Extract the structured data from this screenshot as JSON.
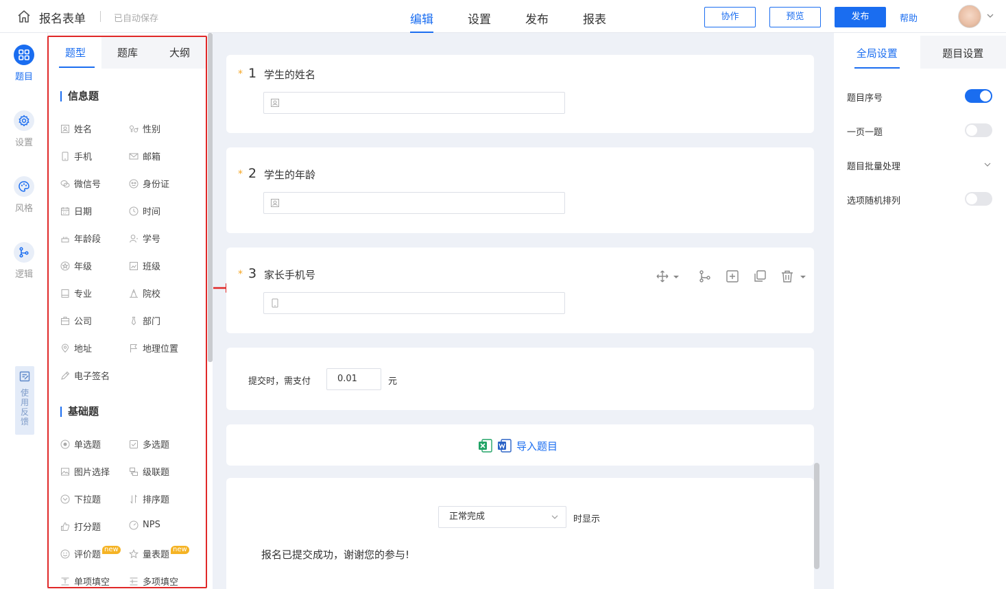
{
  "header": {
    "title": "报名表单",
    "autosave": "已自动保存",
    "tabs": [
      "编辑",
      "设置",
      "发布",
      "报表"
    ],
    "buttons": {
      "collaborate": "协作",
      "preview": "预览",
      "publish": "发布"
    },
    "help": "帮助"
  },
  "rail": {
    "items": [
      {
        "label": "题目",
        "icon": "grid-icon"
      },
      {
        "label": "设置",
        "icon": "gear-icon"
      },
      {
        "label": "风格",
        "icon": "palette-icon"
      },
      {
        "label": "逻辑",
        "icon": "logic-icon"
      }
    ],
    "feedback": "使用反馈"
  },
  "panel": {
    "tabs": [
      "题型",
      "题库",
      "大纲"
    ],
    "info_title": "信息题",
    "info_items": [
      "姓名",
      "性别",
      "手机",
      "邮箱",
      "微信号",
      "身份证",
      "日期",
      "时间",
      "年龄段",
      "学号",
      "年级",
      "班级",
      "专业",
      "院校",
      "公司",
      "部门",
      "地址",
      "地理位置",
      "电子签名"
    ],
    "basic_title": "基础题",
    "basic_items": [
      "单选题",
      "多选题",
      "图片选择",
      "级联题",
      "下拉题",
      "排序题",
      "打分题",
      "NPS",
      "评价题",
      "量表题",
      "单项填空",
      "多项填空"
    ],
    "new_badge": "new"
  },
  "questions": [
    {
      "star": "*",
      "num": "1",
      "title": "学生的姓名"
    },
    {
      "star": "*",
      "num": "2",
      "title": "学生的年龄"
    },
    {
      "star": "*",
      "num": "3",
      "title": "家长手机号"
    }
  ],
  "payment": {
    "label": "提交时，需支付",
    "value": "0.01",
    "unit": "元"
  },
  "import": {
    "label": "导入题目"
  },
  "completion": {
    "select": "正常完成",
    "suffix": "时显示",
    "message": "报名已提交成功，谢谢您的参与!"
  },
  "right": {
    "tabs": [
      "全局设置",
      "题目设置"
    ],
    "settings": [
      {
        "label": "题目序号",
        "on": true
      },
      {
        "label": "一页一题",
        "on": false
      },
      {
        "label": "题目批量处理"
      },
      {
        "label": "选项随机排列",
        "on": false
      }
    ]
  },
  "colors": {
    "accent": "#1a6df0",
    "highlight": "#e02727",
    "required": "#f5a623"
  }
}
